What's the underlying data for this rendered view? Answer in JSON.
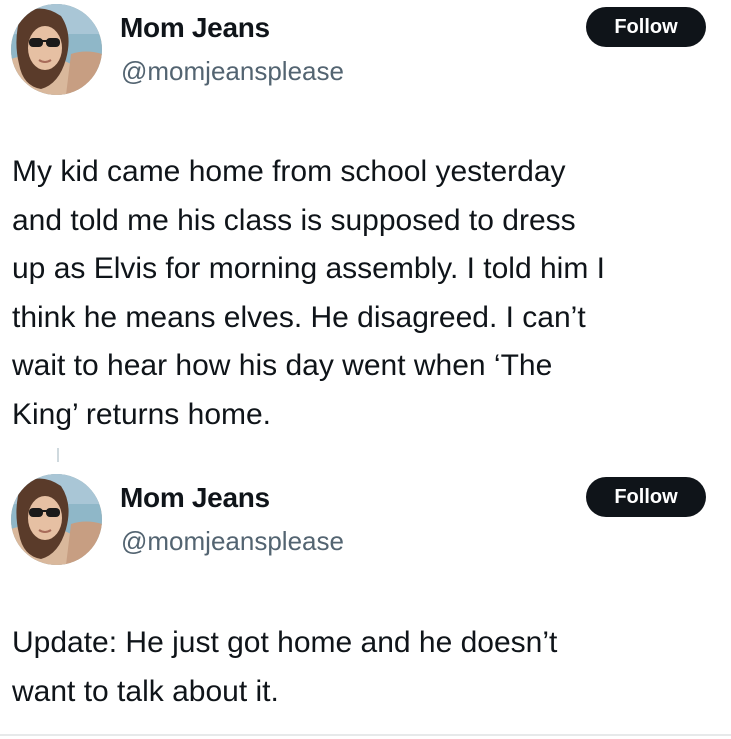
{
  "tweets": [
    {
      "author": {
        "display_name": "Mom Jeans",
        "handle": "@momjeansplease",
        "avatar_icon": "profile-photo"
      },
      "follow_label": "Follow",
      "lines": [
        "My kid came home from school yesterday",
        "and told me his class is supposed to dress",
        "up as Elvis for morning assembly. I told him I",
        "think he means elves. He disagreed. I can’t",
        "wait to hear how his day went when ‘The",
        "King’ returns home."
      ]
    },
    {
      "author": {
        "display_name": "Mom Jeans",
        "handle": "@momjeansplease",
        "avatar_icon": "profile-photo"
      },
      "follow_label": "Follow",
      "lines": [
        "Update: He just got home and he doesn’t",
        "want to talk about it."
      ]
    }
  ],
  "colors": {
    "text": "#0f1419",
    "secondary_text": "#536471",
    "follow_button_bg": "#0f1419",
    "follow_button_text": "#ffffff",
    "background": "#ffffff"
  }
}
